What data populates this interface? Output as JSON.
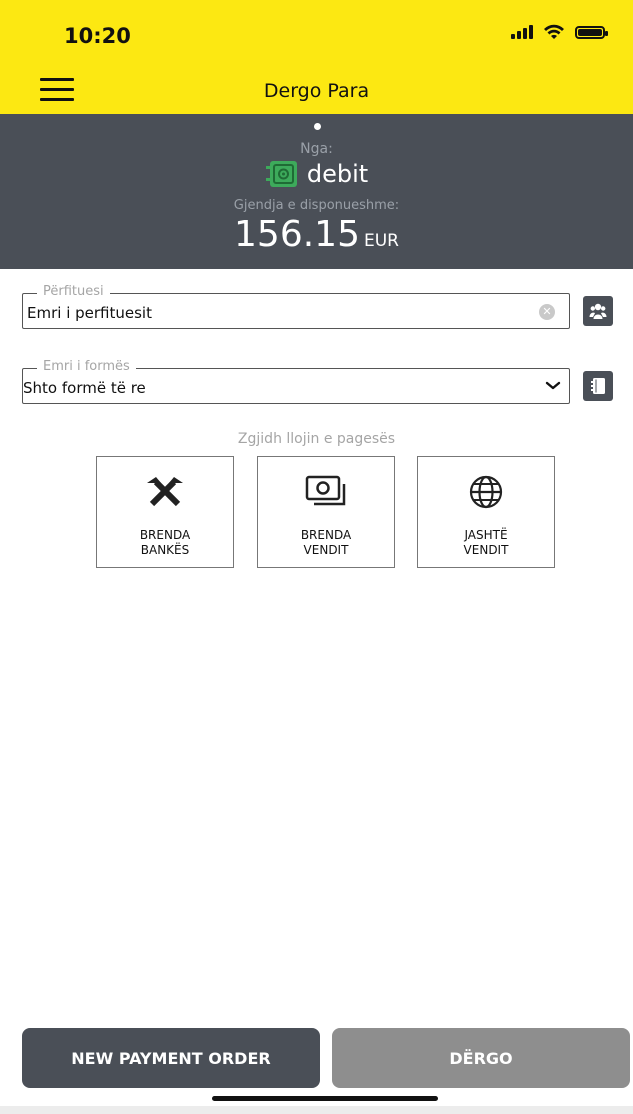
{
  "status_bar": {
    "time": "10:20"
  },
  "header": {
    "title": "Dergo Para"
  },
  "account": {
    "from_label": "Nga:",
    "name": "debit",
    "available_label": "Gjendja e disponueshme:",
    "balance": "156.15",
    "currency": "EUR"
  },
  "beneficiary": {
    "legend": "Përfituesi",
    "value": "Emri i perfituesit"
  },
  "form": {
    "legend": "Emri i formës",
    "value": "Shto formë të re"
  },
  "payment_type": {
    "label": "Zgjidh llojin e pagesës",
    "options": [
      {
        "line1": "BRENDA",
        "line2": "BANKËS",
        "icon": "raiffeisen-icon"
      },
      {
        "line1": "BRENDA",
        "line2": "VENDIT",
        "icon": "banknote-icon"
      },
      {
        "line1": "JASHTË",
        "line2": "VENDIT",
        "icon": "globe-icon"
      }
    ]
  },
  "buttons": {
    "new_payment_order": "NEW PAYMENT ORDER",
    "send": "DËRGO"
  },
  "colors": {
    "brand_yellow": "#fce812",
    "panel_gray": "#4a4f57",
    "disabled_gray": "#8e8e8e"
  }
}
